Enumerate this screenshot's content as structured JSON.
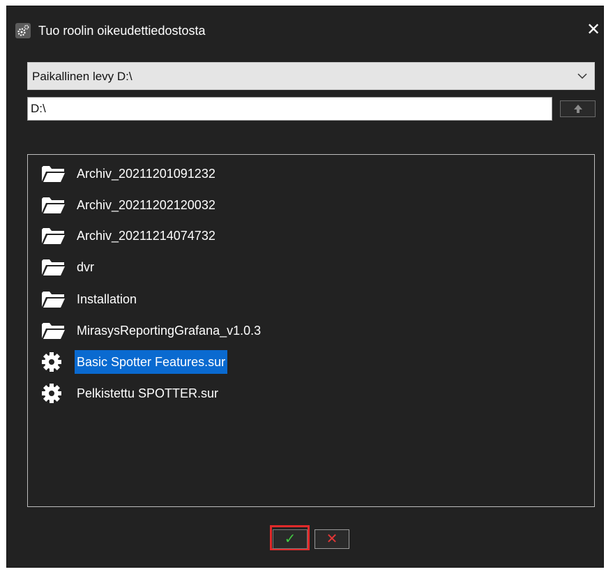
{
  "dialog": {
    "title": "Tuo roolin oikeudettiedostosta",
    "close_symbol": "✕"
  },
  "drive_select": {
    "value": "Paikallinen levy D:\\"
  },
  "path_input": {
    "value": "D:\\"
  },
  "files": [
    {
      "name": "Archiv_20211201091232",
      "icon": "folder-icon"
    },
    {
      "name": "Archiv_20211202120032",
      "icon": "folder-icon"
    },
    {
      "name": "Archiv_20211214074732",
      "icon": "folder-icon"
    },
    {
      "name": "dvr",
      "icon": "folder-icon"
    },
    {
      "name": "Installation",
      "icon": "folder-icon"
    },
    {
      "name": "MirasysReportingGrafana_v1.0.3",
      "icon": "folder-icon"
    },
    {
      "name": "Basic Spotter Features.sur",
      "icon": "gear-icon",
      "selected": true
    },
    {
      "name": "Pelkistettu SPOTTER.sur",
      "icon": "gear-icon"
    }
  ],
  "buttons": {
    "ok_symbol": "✓",
    "cancel_symbol": "✕"
  },
  "colors": {
    "background": "#222222",
    "selection": "#0a6ad0",
    "ok_green": "#42c742",
    "cancel_red": "#e33636",
    "highlight_red": "#e02a2a"
  }
}
